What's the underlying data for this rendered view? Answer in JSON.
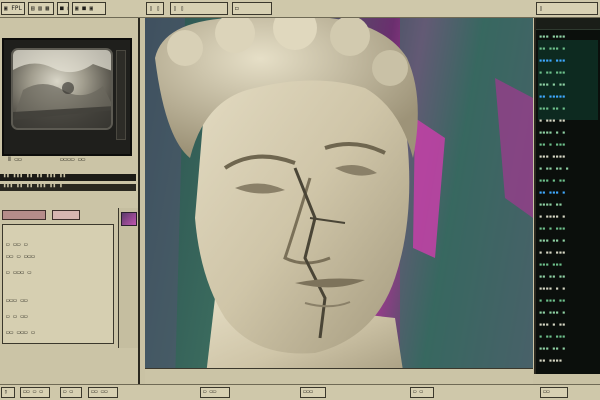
{
  "top_bar": {
    "cells": [
      "▣ FPL",
      "▤ ▥ ▦",
      "■ ▢",
      "▣ ■ ▣",
      "▯ ▯",
      "▯ ▯",
      "◻",
      "▯"
    ]
  },
  "left_panel": {
    "readout_1": "Ⅱ  ▭▭",
    "readout_2": "▭▭▭▭  ▭▭",
    "bar_1": "▮▮ ▮▮▮ ▮▮ ▮▮ ▮▮▮ ▮▮",
    "bar_2": "▮▮▮ ▮▮ ▮▮ ▮▮▮ ▮▮ ▮",
    "rows": [
      "▭ ▭▭ ▭",
      "▭▭ ▭ ▭▭▭",
      "▭ ▭▭▭ ▭",
      "▭▭▭ ▭▭",
      "▭ ▭ ▭▭",
      "▭▭ ▭▭▭ ▭"
    ]
  },
  "bottom_bar": {
    "cells": [
      "▯",
      "▭▭ ▭ ▭",
      "▭ ▭",
      "▭▭ ▭▭",
      "▭ ▭▭",
      "▭▭▭",
      "▭ ▭",
      "▭▭"
    ]
  },
  "terminal": {
    "lines": [
      {
        "t": "▪▪▪ ▪▪▪▪",
        "c": "#8fd2a4"
      },
      {
        "t": "▪▪ ▪▪▪ ▪",
        "c": "#6ec28c"
      },
      {
        "t": "▪▪▪▪ ▪▪▪",
        "c": "#3fa9ff"
      },
      {
        "t": "▪ ▪▪ ▪▪▪",
        "c": "#6ec28c"
      },
      {
        "t": "▪▪▪ ▪ ▪▪",
        "c": "#8fd2a4"
      },
      {
        "t": "▪▪ ▪▪▪▪▪",
        "c": "#3fa9ff"
      },
      {
        "t": "▪▪▪ ▪▪ ▪",
        "c": "#6ec28c"
      },
      {
        "t": "▪ ▪▪▪ ▪▪",
        "c": "#d7d7c4"
      },
      {
        "t": "▪▪▪▪ ▪ ▪",
        "c": "#8fd2a4"
      },
      {
        "t": "▪▪ ▪ ▪▪▪",
        "c": "#6ec28c"
      },
      {
        "t": "▪▪▪ ▪▪▪▪",
        "c": "#d7d7c4"
      },
      {
        "t": "▪ ▪▪ ▪▪ ▪",
        "c": "#8fd2a4"
      },
      {
        "t": "▪▪▪ ▪ ▪▪",
        "c": "#6ec28c"
      },
      {
        "t": "▪▪ ▪▪▪ ▪",
        "c": "#3fa9ff"
      },
      {
        "t": "▪▪▪▪ ▪▪",
        "c": "#8fd2a4"
      },
      {
        "t": "▪ ▪▪▪▪ ▪",
        "c": "#d7d7c4"
      },
      {
        "t": "▪▪ ▪ ▪▪▪",
        "c": "#6ec28c"
      },
      {
        "t": "▪▪▪ ▪▪ ▪",
        "c": "#8fd2a4"
      },
      {
        "t": "▪ ▪▪ ▪▪▪",
        "c": "#d7d7c4"
      },
      {
        "t": "▪▪▪ ▪▪▪",
        "c": "#6ec28c"
      },
      {
        "t": "▪▪ ▪▪ ▪▪",
        "c": "#8fd2a4"
      },
      {
        "t": "▪▪▪▪ ▪ ▪",
        "c": "#d7d7c4"
      },
      {
        "t": "▪ ▪▪▪ ▪▪",
        "c": "#6ec28c"
      },
      {
        "t": "▪▪ ▪▪▪ ▪",
        "c": "#8fd2a4"
      },
      {
        "t": "▪▪▪ ▪ ▪▪",
        "c": "#d7d7c4"
      },
      {
        "t": "▪ ▪▪ ▪▪▪",
        "c": "#6ec28c"
      },
      {
        "t": "▪▪▪ ▪▪ ▪",
        "c": "#8fd2a4"
      },
      {
        "t": "▪▪ ▪▪▪▪",
        "c": "#d7d7c4"
      }
    ]
  },
  "colors": {
    "panel_bg": "#c9c2a4",
    "terminal_bg": "#0b0f0c",
    "accent_magenta": "#c054b0",
    "accent_teal": "#3c6d5f",
    "marble": "#d6cfb6"
  },
  "icons": [
    "monitor-icon",
    "thumbnail-icon"
  ]
}
